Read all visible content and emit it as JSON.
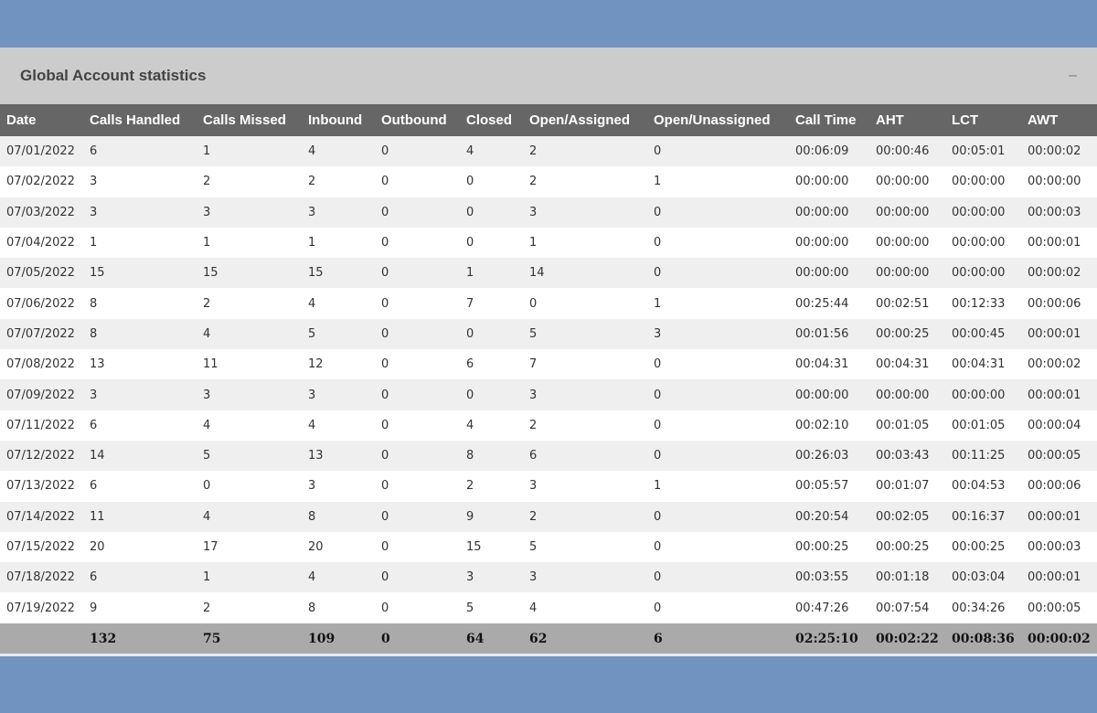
{
  "panel": {
    "title": "Global Account statistics",
    "collapse_label": "–"
  },
  "table": {
    "columns": [
      "Date",
      "Calls Handled",
      "Calls Missed",
      "Inbound",
      "Outbound",
      "Closed",
      "Open/Assigned",
      "Open/Unassigned",
      "Call Time",
      "AHT",
      "LCT",
      "AWT"
    ],
    "rows": [
      [
        "07/01/2022",
        "6",
        "1",
        "4",
        "0",
        "4",
        "2",
        "0",
        "00:06:09",
        "00:00:46",
        "00:05:01",
        "00:00:02"
      ],
      [
        "07/02/2022",
        "3",
        "2",
        "2",
        "0",
        "0",
        "2",
        "1",
        "00:00:00",
        "00:00:00",
        "00:00:00",
        "00:00:00"
      ],
      [
        "07/03/2022",
        "3",
        "3",
        "3",
        "0",
        "0",
        "3",
        "0",
        "00:00:00",
        "00:00:00",
        "00:00:00",
        "00:00:03"
      ],
      [
        "07/04/2022",
        "1",
        "1",
        "1",
        "0",
        "0",
        "1",
        "0",
        "00:00:00",
        "00:00:00",
        "00:00:00",
        "00:00:01"
      ],
      [
        "07/05/2022",
        "15",
        "15",
        "15",
        "0",
        "1",
        "14",
        "0",
        "00:00:00",
        "00:00:00",
        "00:00:00",
        "00:00:02"
      ],
      [
        "07/06/2022",
        "8",
        "2",
        "4",
        "0",
        "7",
        "0",
        "1",
        "00:25:44",
        "00:02:51",
        "00:12:33",
        "00:00:06"
      ],
      [
        "07/07/2022",
        "8",
        "4",
        "5",
        "0",
        "0",
        "5",
        "3",
        "00:01:56",
        "00:00:25",
        "00:00:45",
        "00:00:01"
      ],
      [
        "07/08/2022",
        "13",
        "11",
        "12",
        "0",
        "6",
        "7",
        "0",
        "00:04:31",
        "00:04:31",
        "00:04:31",
        "00:00:02"
      ],
      [
        "07/09/2022",
        "3",
        "3",
        "3",
        "0",
        "0",
        "3",
        "0",
        "00:00:00",
        "00:00:00",
        "00:00:00",
        "00:00:01"
      ],
      [
        "07/11/2022",
        "6",
        "4",
        "4",
        "0",
        "4",
        "2",
        "0",
        "00:02:10",
        "00:01:05",
        "00:01:05",
        "00:00:04"
      ],
      [
        "07/12/2022",
        "14",
        "5",
        "13",
        "0",
        "8",
        "6",
        "0",
        "00:26:03",
        "00:03:43",
        "00:11:25",
        "00:00:05"
      ],
      [
        "07/13/2022",
        "6",
        "0",
        "3",
        "0",
        "2",
        "3",
        "1",
        "00:05:57",
        "00:01:07",
        "00:04:53",
        "00:00:06"
      ],
      [
        "07/14/2022",
        "11",
        "4",
        "8",
        "0",
        "9",
        "2",
        "0",
        "00:20:54",
        "00:02:05",
        "00:16:37",
        "00:00:01"
      ],
      [
        "07/15/2022",
        "20",
        "17",
        "20",
        "0",
        "15",
        "5",
        "0",
        "00:00:25",
        "00:00:25",
        "00:00:25",
        "00:00:03"
      ],
      [
        "07/18/2022",
        "6",
        "1",
        "4",
        "0",
        "3",
        "3",
        "0",
        "00:03:55",
        "00:01:18",
        "00:03:04",
        "00:00:01"
      ],
      [
        "07/19/2022",
        "9",
        "2",
        "8",
        "0",
        "5",
        "4",
        "0",
        "00:47:26",
        "00:07:54",
        "00:34:26",
        "00:00:05"
      ]
    ],
    "totals": [
      "",
      "132",
      "75",
      "109",
      "0",
      "64",
      "62",
      "6",
      "02:25:10",
      "00:02:22",
      "00:08:36",
      "00:00:02"
    ]
  },
  "colors": {
    "page_background": "#7093c0",
    "header_bar": "#cccccc",
    "table_header": "#666666",
    "row_odd": "#efefef",
    "row_even": "#ffffff",
    "totals_row": "#aaaaaa"
  }
}
